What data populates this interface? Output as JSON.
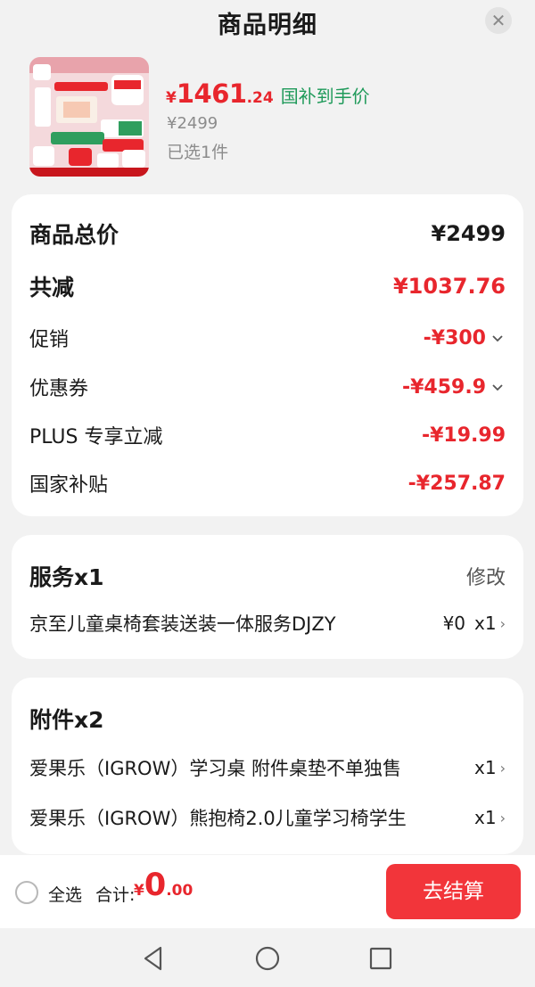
{
  "header": {
    "title": "商品明细",
    "close_glyph": "✕"
  },
  "product": {
    "currency": "¥",
    "price_int": "1461",
    "price_dec": ".24",
    "price_tag": "国补到手价",
    "original_price": "¥2499",
    "selected_count": "已选1件"
  },
  "summary": {
    "rows": [
      {
        "label": "商品总价",
        "value": "¥2499"
      },
      {
        "label": "共减",
        "value": "¥1037.76"
      },
      {
        "label": "促销",
        "value": "-¥300"
      },
      {
        "label": "优惠券",
        "value": "-¥459.9"
      },
      {
        "label": "PLUS 专享立减",
        "value": "-¥19.99"
      },
      {
        "label": "国家补贴",
        "value": "-¥257.87"
      }
    ]
  },
  "service": {
    "title": "服务x1",
    "modify_label": "修改",
    "item_name": "京至儿童桌椅套装送装一体服务DJZY",
    "item_price": "¥0",
    "item_qty": "x1"
  },
  "accessories": {
    "title": "附件x2",
    "items": [
      {
        "name": "爱果乐（IGROW）学习桌 附件桌垫不单独售",
        "qty": "x1"
      },
      {
        "name": "爱果乐（IGROW）熊抱椅2.0儿童学习椅学生",
        "qty": "x1"
      }
    ]
  },
  "footer": {
    "select_all": "全选",
    "total_label": "合计:",
    "total_currency": "¥",
    "total_int": "0",
    "total_dec": ".00",
    "checkout_label": "去结算"
  },
  "colors": {
    "accent": "#e8262d",
    "green": "#1f9a5a",
    "checkout": "#f2353a"
  },
  "icons": [
    "close-icon",
    "chevron-down-icon",
    "chevron-right-icon",
    "back-icon",
    "home-icon",
    "recents-icon"
  ]
}
